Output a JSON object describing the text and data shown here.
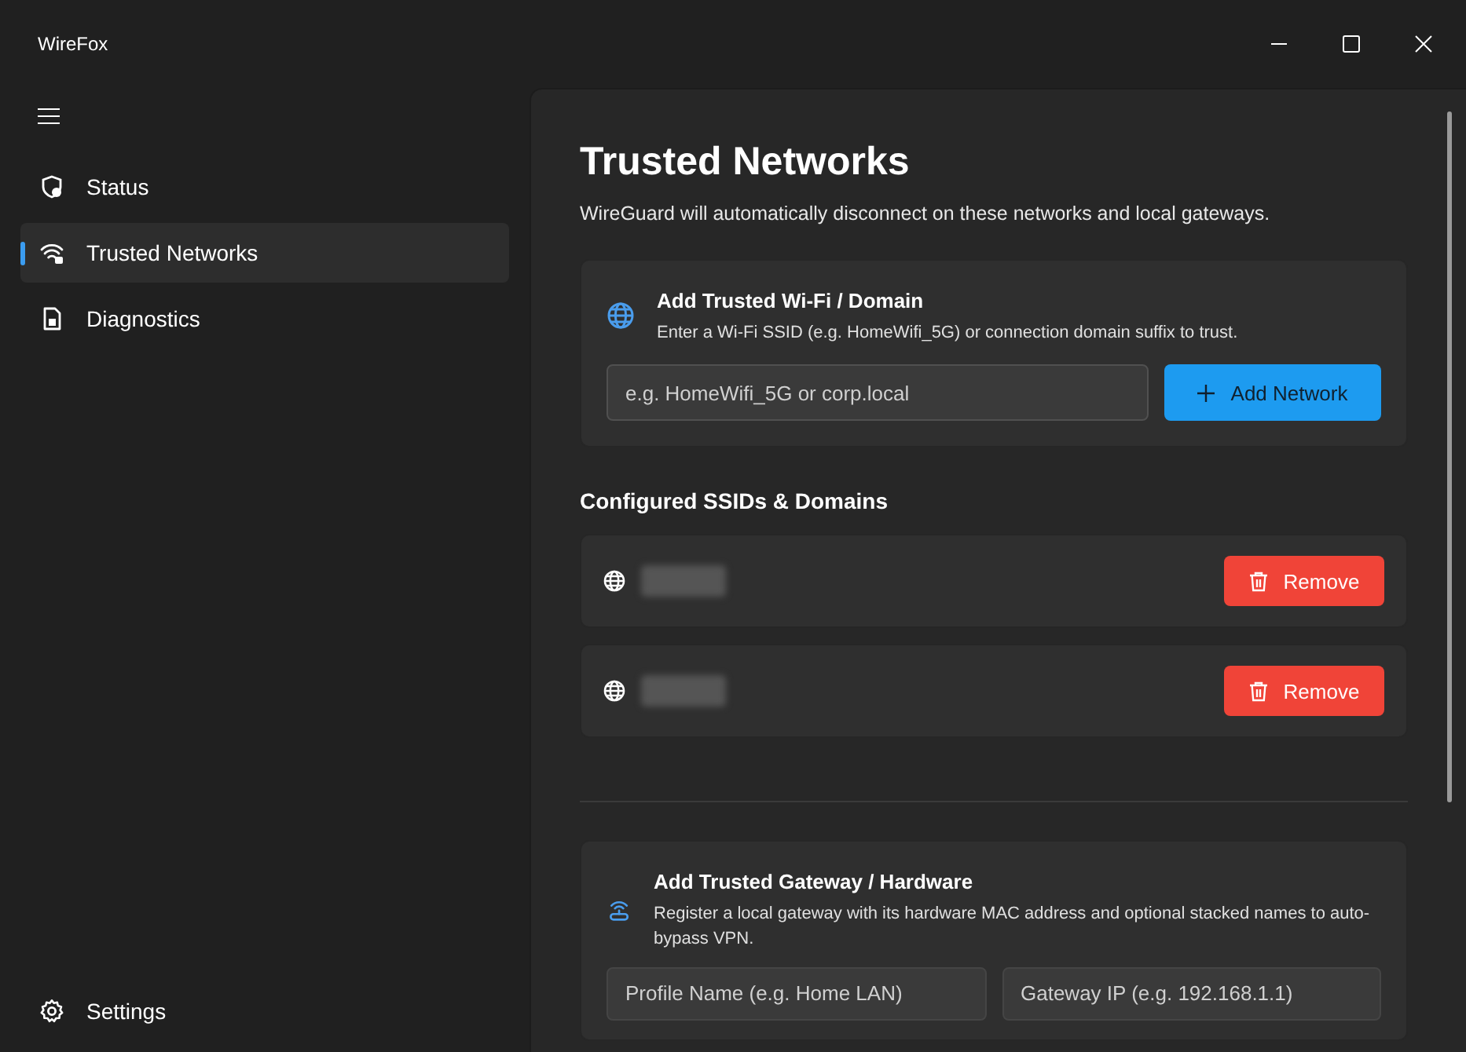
{
  "window": {
    "title": "WireFox"
  },
  "sidebar": {
    "items": [
      {
        "label": "Status",
        "selected": false
      },
      {
        "label": "Trusted Networks",
        "selected": true
      },
      {
        "label": "Diagnostics",
        "selected": false
      }
    ],
    "footer": {
      "label": "Settings"
    }
  },
  "page": {
    "title": "Trusted Networks",
    "subtitle": "WireGuard will automatically disconnect on these networks and local gateways."
  },
  "wifi_card": {
    "title": "Add Trusted Wi-Fi / Domain",
    "description": "Enter a Wi-Fi SSID (e.g. HomeWifi_5G) or connection domain suffix to trust.",
    "placeholder": "e.g. HomeWifi_5G or corp.local",
    "button": "Add Network"
  },
  "configured": {
    "heading": "Configured SSIDs & Domains",
    "items": [
      {
        "redacted": true,
        "button": "Remove"
      },
      {
        "redacted": true,
        "button": "Remove"
      }
    ]
  },
  "gateway_card": {
    "title": "Add Trusted Gateway / Hardware",
    "description": "Register a local gateway with its hardware MAC address and optional stacked names to auto-bypass VPN.",
    "fields": [
      {
        "placeholder": "Profile Name (e.g. Home LAN)"
      },
      {
        "placeholder": "Gateway IP (e.g. 192.168.1.1)"
      }
    ]
  }
}
